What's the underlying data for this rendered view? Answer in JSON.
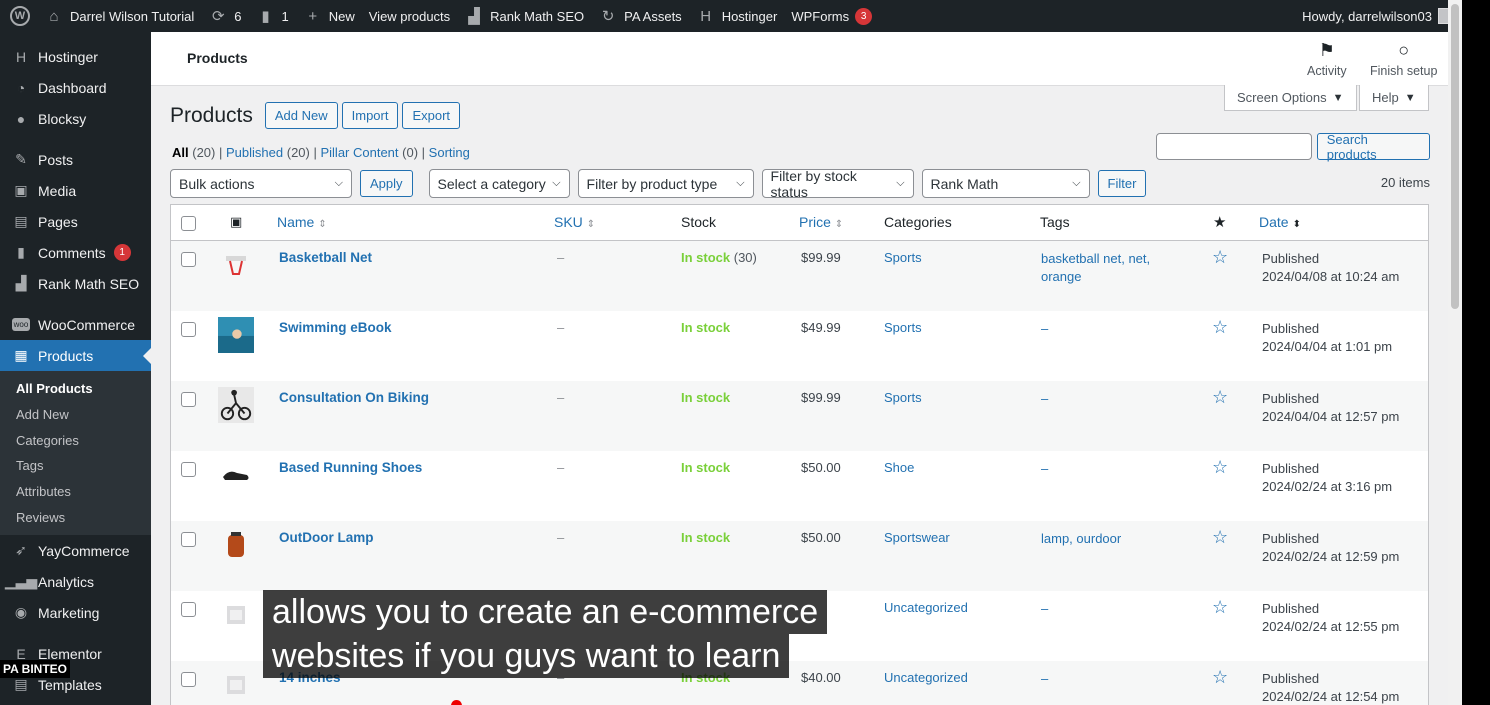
{
  "adminbar": {
    "site_name": "Darrel Wilson Tutorial",
    "updates_count": "6",
    "comments_count": "1",
    "new_label": "New",
    "view_products": "View products",
    "rankmath": "Rank Math SEO",
    "pa_assets": "PA Assets",
    "hostinger": "Hostinger",
    "wpforms": "WPForms",
    "wpforms_badge": "3",
    "howdy": "Howdy, darrelwilson03"
  },
  "sidebar": {
    "items": [
      {
        "label": "Hostinger",
        "icon": "hostinger-icon"
      },
      {
        "label": "Dashboard",
        "icon": "dashboard-icon"
      },
      {
        "label": "Blocksy",
        "icon": "blocksy-icon"
      },
      {
        "label": "Posts",
        "icon": "pin-icon"
      },
      {
        "label": "Media",
        "icon": "media-icon"
      },
      {
        "label": "Pages",
        "icon": "pages-icon"
      },
      {
        "label": "Comments",
        "icon": "comments-icon",
        "badge": "1"
      },
      {
        "label": "Rank Math SEO",
        "icon": "rankmath-icon"
      },
      {
        "label": "WooCommerce",
        "icon": "woo-icon"
      },
      {
        "label": "Products",
        "icon": "products-icon"
      },
      {
        "label": "YayCommerce",
        "icon": "yay-icon"
      },
      {
        "label": "Analytics",
        "icon": "analytics-icon"
      },
      {
        "label": "Marketing",
        "icon": "marketing-icon"
      },
      {
        "label": "Elementor",
        "icon": "elementor-icon"
      },
      {
        "label": "Templates",
        "icon": "templates-icon"
      }
    ],
    "submenu": [
      "All Products",
      "Add New",
      "Categories",
      "Tags",
      "Attributes",
      "Reviews"
    ]
  },
  "header": {
    "title": "Products",
    "activity": "Activity",
    "finish_setup": "Finish setup",
    "screen_options": "Screen Options",
    "help": "Help"
  },
  "page": {
    "heading": "Products",
    "add_new": "Add New",
    "import": "Import",
    "export": "Export",
    "views": {
      "all": "All",
      "all_count": "(20)",
      "published": "Published",
      "published_count": "(20)",
      "pillar": "Pillar Content",
      "pillar_count": "(0)",
      "sorting": "Sorting"
    },
    "search_button": "Search products",
    "bulk_actions": "Bulk actions",
    "apply": "Apply",
    "category": "Select a category",
    "product_type": "Filter by product type",
    "stock_status": "Filter by stock status",
    "rank_math": "Rank Math",
    "filter": "Filter",
    "items_count": "20 items"
  },
  "table": {
    "columns": {
      "name": "Name",
      "sku": "SKU",
      "stock": "Stock",
      "price": "Price",
      "categories": "Categories",
      "tags": "Tags",
      "date": "Date"
    },
    "rows": [
      {
        "name": "Basketball Net",
        "sku": "–",
        "stock": "In stock",
        "qty": "(30)",
        "price": "$99.99",
        "category": "Sports",
        "tags": "basketball net, net,",
        "tags2": "orange",
        "status": "Published",
        "date": "2024/04/08 at 10:24 am"
      },
      {
        "name": "Swimming eBook",
        "sku": "–",
        "stock": "In stock",
        "qty": "",
        "price": "$49.99",
        "category": "Sports",
        "tags": "–",
        "tags2": "",
        "status": "Published",
        "date": "2024/04/04 at 1:01 pm"
      },
      {
        "name": "Consultation On Biking",
        "sku": "–",
        "stock": "In stock",
        "qty": "",
        "price": "$99.99",
        "category": "Sports",
        "tags": "–",
        "tags2": "",
        "status": "Published",
        "date": "2024/04/04 at 12:57 pm"
      },
      {
        "name": "Based Running Shoes",
        "sku": "–",
        "stock": "In stock",
        "qty": "",
        "price": "$50.00",
        "category": "Shoe",
        "tags": "–",
        "tags2": "",
        "status": "Published",
        "date": "2024/02/24 at 3:16 pm"
      },
      {
        "name": "OutDoor Lamp",
        "sku": "–",
        "stock": "In stock",
        "qty": "",
        "price": "$50.00",
        "category": "Sportswear",
        "tags": "lamp, ourdoor",
        "tags2": "",
        "status": "Published",
        "date": "2024/02/24 at 12:59 pm"
      },
      {
        "name": "",
        "sku": "",
        "stock": "",
        "qty": "",
        "price": "",
        "category": "Uncategorized",
        "tags": "–",
        "tags2": "",
        "status": "Published",
        "date": "2024/02/24 at 12:55 pm"
      },
      {
        "name": "14 inches",
        "sku": "–",
        "stock": "In stock",
        "qty": "",
        "price": "$40.00",
        "category": "Uncategorized",
        "tags": "–",
        "tags2": "",
        "status": "Published",
        "date": "2024/02/24 at 12:54 pm"
      }
    ]
  },
  "caption": {
    "line1": "allows you to create an e-commerce",
    "line2": "websites if you guys want to learn"
  },
  "watermark": "PA BINTEO"
}
